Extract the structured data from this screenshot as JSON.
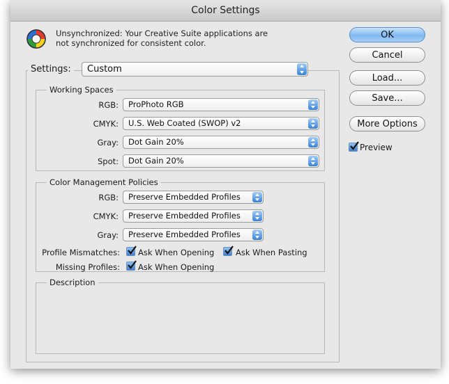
{
  "window": {
    "title": "Color Settings"
  },
  "sync_message": {
    "line1": "Unsynchronized: Your Creative Suite applications are",
    "line2": "not synchronized for consistent color."
  },
  "buttons": {
    "ok": "OK",
    "cancel": "Cancel",
    "load": "Load...",
    "save": "Save...",
    "more_options": "More Options"
  },
  "preview": {
    "label": "Preview",
    "checked": true
  },
  "settings": {
    "label": "Settings:",
    "value": "Custom"
  },
  "working_spaces": {
    "title": "Working Spaces",
    "rgb": {
      "label": "RGB:",
      "value": "ProPhoto RGB"
    },
    "cmyk": {
      "label": "CMYK:",
      "value": "U.S. Web Coated (SWOP) v2"
    },
    "gray": {
      "label": "Gray:",
      "value": "Dot Gain 20%"
    },
    "spot": {
      "label": "Spot:",
      "value": "Dot Gain 20%"
    }
  },
  "policies": {
    "title": "Color Management Policies",
    "rgb": {
      "label": "RGB:",
      "value": "Preserve Embedded Profiles"
    },
    "cmyk": {
      "label": "CMYK:",
      "value": "Preserve Embedded Profiles"
    },
    "gray": {
      "label": "Gray:",
      "value": "Preserve Embedded Profiles"
    },
    "profile_mismatches": {
      "label": "Profile Mismatches:",
      "ask_opening": "Ask When Opening",
      "ask_pasting": "Ask When Pasting"
    },
    "missing_profiles": {
      "label": "Missing Profiles:",
      "ask_opening": "Ask When Opening"
    }
  },
  "description": {
    "title": "Description"
  },
  "icons": {
    "sync": "color-wheel-icon",
    "checkbox": "checkmark-icon",
    "popup": "updown-arrows-icon"
  },
  "colors": {
    "accent": "#3a82d6",
    "dialog_bg": "#e8e8e8"
  }
}
